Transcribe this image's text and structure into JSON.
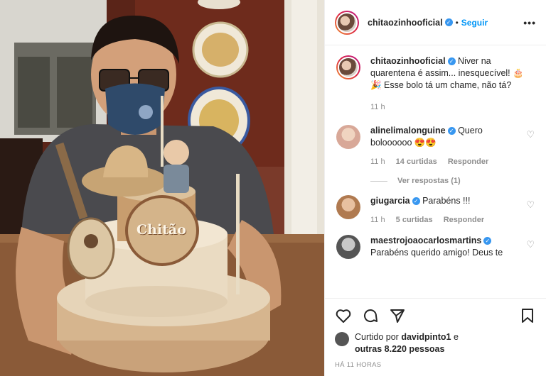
{
  "post": {
    "username": "chitaozinhooficial",
    "follow_label": "Seguir",
    "more_label": "•••"
  },
  "caption": {
    "username": "chitaozinhooficial",
    "text": "Niver na quarentena é assim... inesquecível! 🎂🎉 Esse bolo tá um chame, não tá?",
    "time": "11 h"
  },
  "comments": [
    {
      "username": "alinelimalonguine",
      "text": "Quero boloooooo 😍😍",
      "time": "11 h",
      "likes": "14 curtidas",
      "reply": "Responder",
      "view_replies": "Ver respostas (1)"
    },
    {
      "username": "giugarcia",
      "text": "Parabéns !!!",
      "time": "11 h",
      "likes": "5 curtidas",
      "reply": "Responder"
    },
    {
      "username": "maestrojoaocarlosmartins",
      "text": "Parabéns querido amigo! Deus te"
    }
  ],
  "likes": {
    "prefix": "Curtido por",
    "user": "davidpinto1",
    "suffix": "e",
    "others": "outras 8.220 pessoas"
  },
  "timestamp": "HÁ 11 HORAS",
  "photo": {
    "cake_text": "Chitão"
  },
  "icons": [
    "heart-icon",
    "comment-icon",
    "share-icon",
    "bookmark-icon",
    "verified-icon",
    "more-icon"
  ],
  "colors": {
    "accent": "#0095f6",
    "verified": "#3897f0",
    "muted": "#8e8e8e"
  }
}
